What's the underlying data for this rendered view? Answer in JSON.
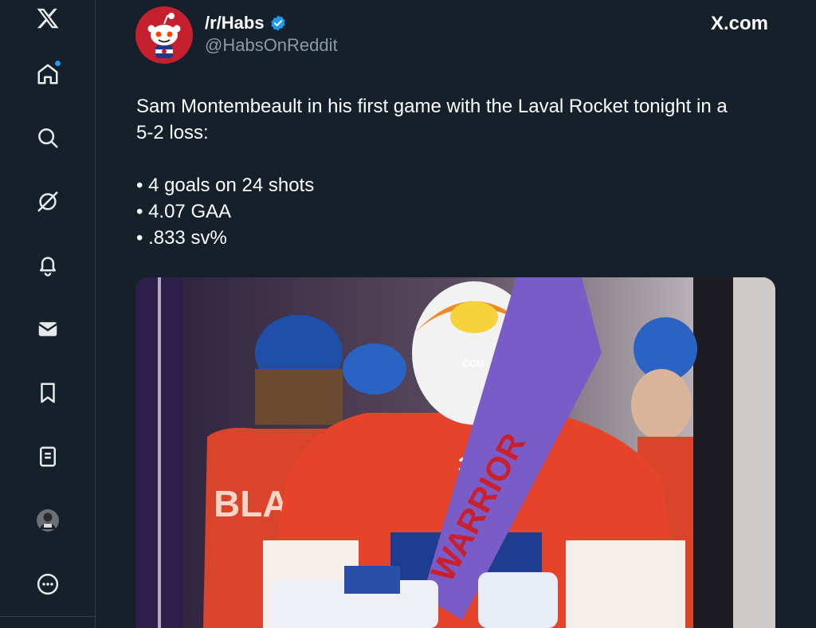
{
  "sidebar": {
    "logo": "x-logo-icon",
    "items": [
      {
        "name": "home",
        "icon": "home-icon",
        "has_notification": true
      },
      {
        "name": "explore",
        "icon": "search-icon"
      },
      {
        "name": "grok",
        "icon": "grok-icon"
      },
      {
        "name": "notifications",
        "icon": "bell-icon"
      },
      {
        "name": "messages",
        "icon": "envelope-icon"
      },
      {
        "name": "bookmarks",
        "icon": "bookmark-icon"
      },
      {
        "name": "lists",
        "icon": "list-icon"
      },
      {
        "name": "profile",
        "icon": "profile-avatar"
      },
      {
        "name": "more",
        "icon": "more-icon"
      }
    ]
  },
  "post": {
    "display_name": "/r/Habs",
    "verified": true,
    "handle": "@HabsOnReddit",
    "source": "X.com",
    "text_lines": [
      "Sam Montembeault in his first game with the Laval Rocket tonight in a",
      "5-2 loss:"
    ],
    "stats": [
      "• 4 goals on 24 shots",
      "• 4.07 GAA",
      "• .833 sv%"
    ],
    "image_text": {
      "stick": "WARRIOR",
      "jersey_name": "BLAIS",
      "number": "35",
      "helmet_brand": "CCM"
    }
  },
  "colors": {
    "background": "#15202b",
    "accent": "#1d9bf0",
    "secondary_text": "#8b98a5"
  }
}
